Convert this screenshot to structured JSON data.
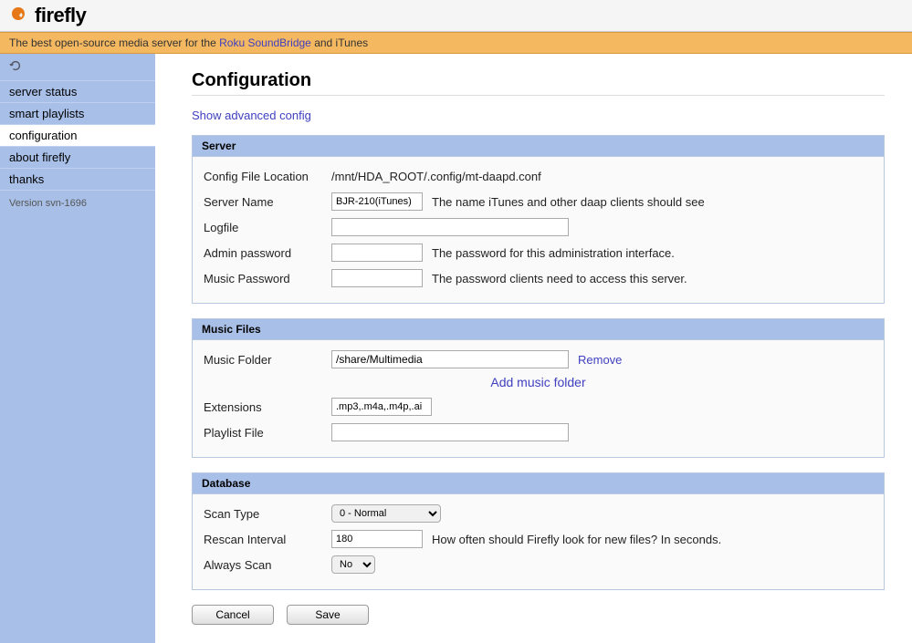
{
  "logo_text": "firefly",
  "tagline_pre": "The best open-source media server for the ",
  "tagline_link": "Roku SoundBridge",
  "tagline_post": " and iTunes",
  "sidebar": {
    "items": [
      {
        "label": "server status"
      },
      {
        "label": "smart playlists"
      },
      {
        "label": "configuration"
      },
      {
        "label": "about firefly"
      },
      {
        "label": "thanks"
      }
    ],
    "version": "Version svn-1696"
  },
  "page_title": "Configuration",
  "advanced_link": "Show advanced config",
  "sections": {
    "server": {
      "title": "Server",
      "config_file_label": "Config File Location",
      "config_file_value": "/mnt/HDA_ROOT/.config/mt-daapd.conf",
      "server_name_label": "Server Name",
      "server_name_value": "BJR-210(iTunes)",
      "server_name_hint": "The name iTunes and other daap clients should see",
      "logfile_label": "Logfile",
      "logfile_value": "",
      "admin_pw_label": "Admin password",
      "admin_pw_value": "",
      "admin_pw_hint": "The password for this administration interface.",
      "music_pw_label": "Music Password",
      "music_pw_value": "",
      "music_pw_hint": "The password clients need to access this server."
    },
    "music_files": {
      "title": "Music Files",
      "music_folder_label": "Music Folder",
      "music_folder_value": "/share/Multimedia",
      "remove_label": "Remove",
      "add_label": "Add music folder",
      "extensions_label": "Extensions",
      "extensions_value": ".mp3,.m4a,.m4p,.ai",
      "playlist_label": "Playlist File",
      "playlist_value": ""
    },
    "database": {
      "title": "Database",
      "scan_type_label": "Scan Type",
      "scan_type_value": "0 - Normal",
      "rescan_label": "Rescan Interval",
      "rescan_value": "180",
      "rescan_hint": "How often should Firefly look for new files? In seconds.",
      "always_scan_label": "Always Scan",
      "always_scan_value": "No"
    }
  },
  "buttons": {
    "cancel": "Cancel",
    "save": "Save"
  }
}
